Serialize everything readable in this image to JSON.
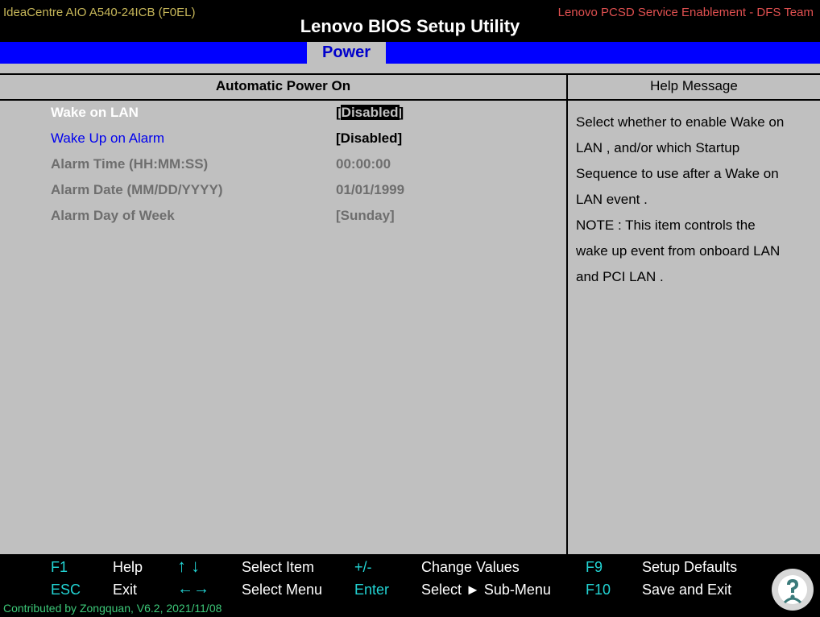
{
  "header": {
    "model": "IdeaCentre AIO A540-24ICB (F0EL)",
    "title": "Lenovo BIOS Setup Utility",
    "team": "Lenovo PCSD Service Enablement - DFS Team"
  },
  "tabs": [
    {
      "label": "Power",
      "active": true
    }
  ],
  "panel": {
    "section_title": "Automatic Power On",
    "help_title": "Help Message"
  },
  "settings": [
    {
      "label": "Wake on LAN",
      "value": "Disabled",
      "state": "selected"
    },
    {
      "label": "Wake Up on Alarm",
      "value": "[Disabled]",
      "state": "enabled"
    },
    {
      "label": "Alarm Time (HH:MM:SS)",
      "value": "00:00:00",
      "state": "disabled"
    },
    {
      "label": "Alarm Date (MM/DD/YYYY)",
      "value": "01/01/1999",
      "state": "disabled"
    },
    {
      "label": "Alarm Day of Week",
      "value": "[Sunday]",
      "state": "disabled"
    }
  ],
  "help_lines": [
    "Select whether to enable Wake on",
    "LAN , and/or which Startup",
    "Sequence to use after a Wake on",
    "LAN event .",
    "NOTE : This item controls the",
    "wake up event from onboard LAN",
    "and PCI LAN ."
  ],
  "footer": {
    "row1": [
      {
        "key": "F1",
        "action": "Help"
      },
      {
        "key": "↑ ↓",
        "action": "Select Item"
      },
      {
        "key": "+/-",
        "action": "Change Values"
      },
      {
        "key": "F9",
        "action": "Setup Defaults"
      }
    ],
    "row2": [
      {
        "key": "ESC",
        "action": "Exit"
      },
      {
        "key": "←→",
        "action": "Select Menu"
      },
      {
        "key": "Enter",
        "action": "Select ► Sub-Menu"
      },
      {
        "key": "F10",
        "action": "Save and Exit"
      }
    ],
    "credit": "Contributed by Zongquan, V6.2, 2021/11/08"
  },
  "colors": {
    "tab_bar": "#0000ff",
    "panel_bg": "#c0c0c0",
    "key_color": "#22d4d4",
    "model_text": "#c8b85a",
    "team_text": "#e05050",
    "credit_text": "#3cc878"
  },
  "icons": {
    "watermark": "question-mark-person-icon"
  }
}
